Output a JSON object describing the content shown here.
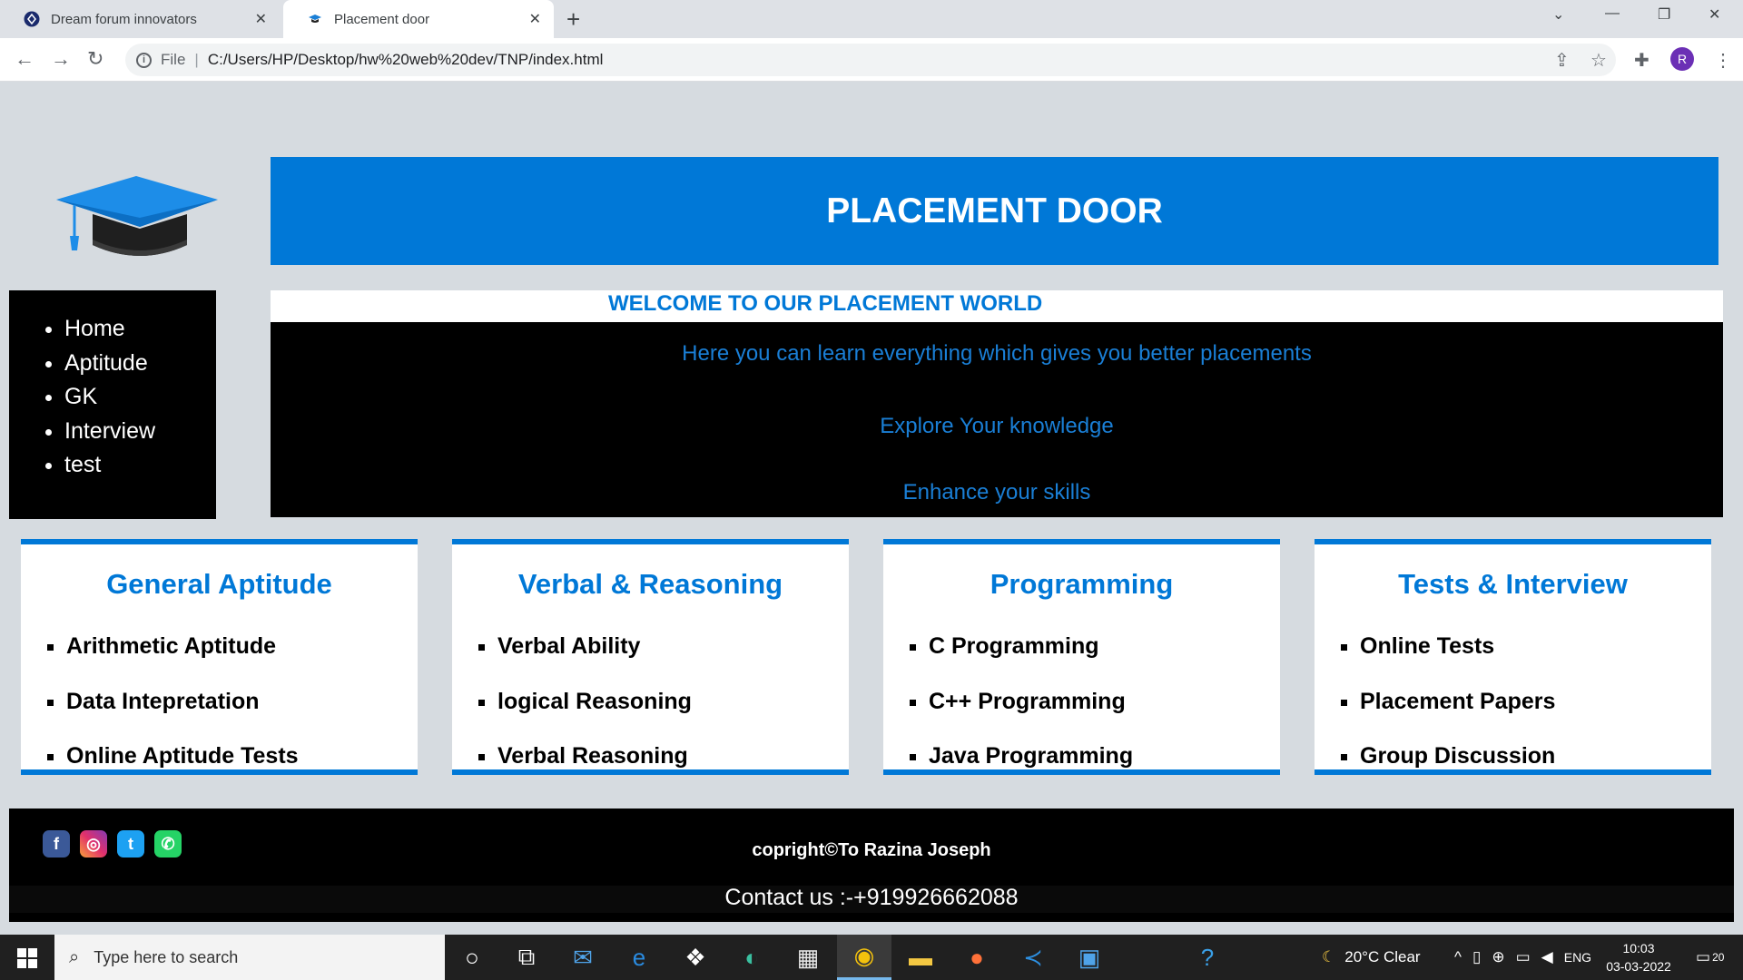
{
  "browser": {
    "tabs": [
      {
        "title": "Dream forum innovators",
        "active": false
      },
      {
        "title": "Placement door",
        "active": true
      }
    ],
    "address": {
      "scheme": "File",
      "url": "C:/Users/HP/Desktop/hw%20web%20dev/TNP/index.html"
    },
    "profile_initial": "R"
  },
  "page": {
    "banner_title": "PLACEMENT DOOR",
    "nav": [
      "Home",
      "Aptitude",
      "GK",
      "Interview",
      "test"
    ],
    "welcome": "WELCOME TO OUR PLACEMENT WORLD",
    "hero_lines": [
      "Here you can learn everything which gives you better placements",
      "Explore Your knowledge",
      "Enhance your skills"
    ],
    "cards": [
      {
        "title": "General Aptitude",
        "items": [
          "Arithmetic Aptitude",
          "Data Intepretation",
          "Online Aptitude Tests"
        ]
      },
      {
        "title": "Verbal & Reasoning",
        "items": [
          "Verbal Ability",
          "logical Reasoning",
          "Verbal Reasoning"
        ]
      },
      {
        "title": "Programming",
        "items": [
          "C Programming",
          "C++ Programming",
          "Java Programming"
        ]
      },
      {
        "title": "Tests & Interview",
        "items": [
          "Online Tests",
          "Placement Papers",
          "Group Discussion"
        ]
      }
    ],
    "footer": {
      "copyright": "copright©To Razina Joseph",
      "contact": "Contact us :-+919926662088",
      "social_icons": [
        "facebook-icon",
        "instagram-icon",
        "twitter-icon",
        "whatsapp-icon"
      ]
    },
    "colors": {
      "brand_blue": "#0078d7",
      "black": "#000000",
      "page_bg": "#d6dbe0"
    }
  },
  "taskbar": {
    "search_placeholder": "Type here to search",
    "weather": "20°C  Clear",
    "language": "ENG",
    "time": "10:03",
    "date": "03-03-2022",
    "notifications": "20"
  }
}
